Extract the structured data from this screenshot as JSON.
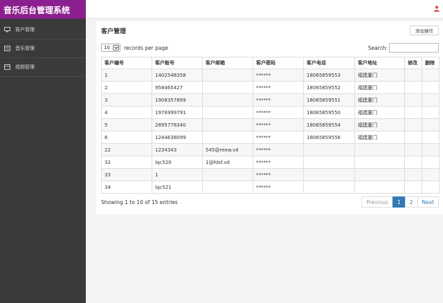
{
  "app": {
    "title": "音乐后台管理系统"
  },
  "sidebar": {
    "items": [
      {
        "label": "客户管理",
        "icon": "monitor-icon"
      },
      {
        "label": "音乐管理",
        "icon": "list-icon"
      },
      {
        "label": "视频管理",
        "icon": "video-icon"
      }
    ]
  },
  "panel": {
    "title": "客户管理",
    "add_button": "添加操作"
  },
  "controls": {
    "page_length": "10",
    "length_suffix": "records per page",
    "search_label": "Search:",
    "search_value": ""
  },
  "table": {
    "headers": [
      "客户编号",
      "客户账号",
      "客户邮箱",
      "客户密码",
      "客户电话",
      "客户地址",
      "修改",
      "删除"
    ],
    "rows": [
      [
        "1",
        "1402548358",
        "",
        "******",
        "18065859553",
        "福建厦门",
        "",
        ""
      ],
      [
        "2",
        "958465427",
        "",
        "******",
        "18065859552",
        "福建厦门",
        "",
        ""
      ],
      [
        "3",
        "1908357899",
        "",
        "******",
        "18065859551",
        "福建厦门",
        "",
        ""
      ],
      [
        "4",
        "1976999791",
        "",
        "******",
        "18065859550",
        "福建厦门",
        "",
        ""
      ],
      [
        "5",
        "2895778340",
        "",
        "******",
        "18065859554",
        "福建厦门",
        "",
        ""
      ],
      [
        "6",
        "1244638099",
        "",
        "******",
        "18065859556",
        "福建厦门",
        "",
        ""
      ],
      [
        "22",
        "1234343",
        "545@reew.vd",
        "******",
        "",
        "",
        "",
        ""
      ],
      [
        "32",
        "lqc520",
        "1@fdsf.vd",
        "******",
        "",
        "",
        "",
        ""
      ],
      [
        "33",
        "1",
        "",
        "******",
        "",
        "",
        "",
        ""
      ],
      [
        "34",
        "lqc521",
        "",
        "******",
        "",
        "",
        "",
        ""
      ]
    ]
  },
  "footer": {
    "info": "Showing 1 to 10 of 15 entries",
    "pagination": {
      "previous": "Previous",
      "pages": [
        "1",
        "2"
      ],
      "active_page": "1",
      "next": "Next"
    }
  },
  "colors": {
    "brand": "#8b1f8f",
    "sidebar": "#3a3a3a",
    "accent": "#337ab7",
    "user_icon": "#d9534f"
  }
}
